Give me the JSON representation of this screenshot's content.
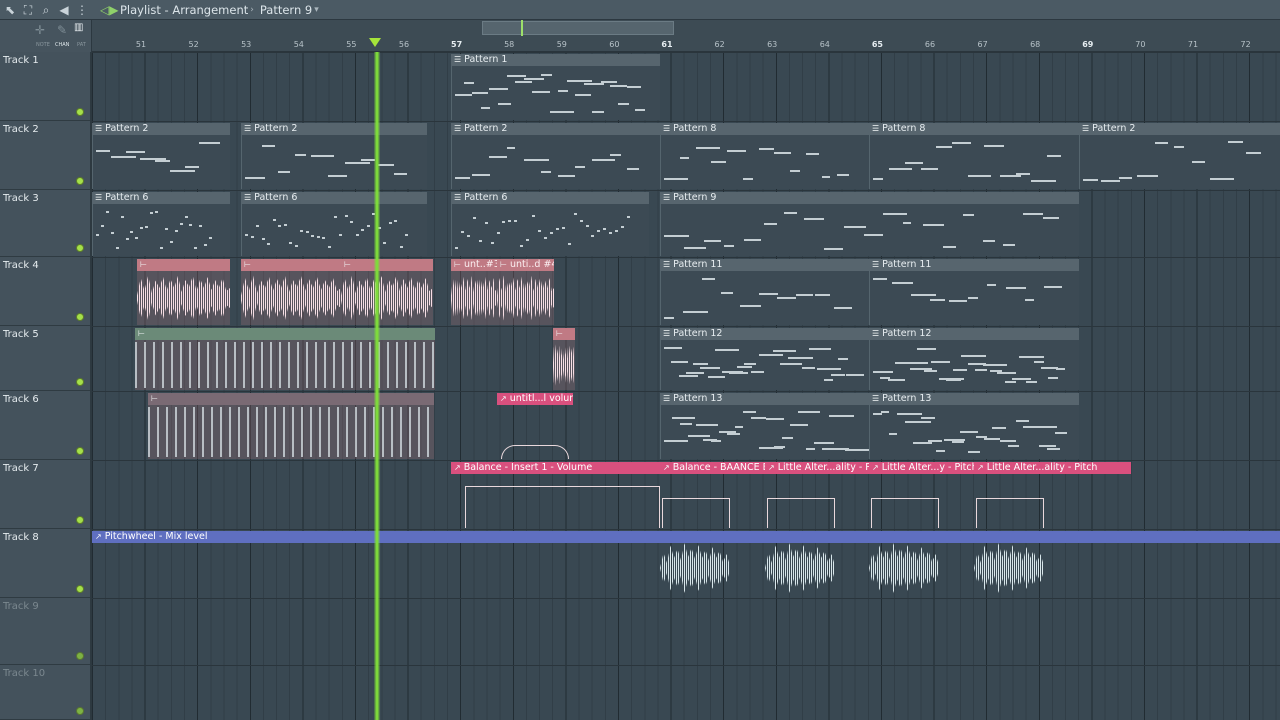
{
  "window": {
    "title": "Playlist - Arrangement",
    "pattern_selector": "Pattern 9"
  },
  "toolbar": {
    "mini_labels": [
      "NOTE",
      "CHAN",
      "PAT"
    ]
  },
  "ruler": {
    "bars": [
      "51",
      "52",
      "53",
      "54",
      "55",
      "56",
      "57",
      "58",
      "59",
      "60",
      "61",
      "62",
      "63",
      "64",
      "65",
      "66",
      "67",
      "68",
      "69",
      "70",
      "71",
      "72"
    ],
    "playhead_bar": 55.5
  },
  "tracks": [
    {
      "name": "Track 1"
    },
    {
      "name": "Track 2"
    },
    {
      "name": "Track 3"
    },
    {
      "name": "Track 4"
    },
    {
      "name": "Track 5"
    },
    {
      "name": "Track 6"
    },
    {
      "name": "Track 7"
    },
    {
      "name": "Track 8"
    },
    {
      "name": "Track 9"
    },
    {
      "name": "Track 10"
    }
  ],
  "clips": {
    "t1": [
      "Pattern 1"
    ],
    "t2": [
      "Pattern 2",
      "Pattern 2",
      "Pattern 2",
      "Pattern 8",
      "Pattern 8",
      "Pattern 2"
    ],
    "t3": [
      "Pattern 6",
      "Pattern 6",
      "Pattern 6",
      "Pattern 9"
    ],
    "t4": [
      "unt..#3",
      "unti..d #4",
      "Pattern 11",
      "Pattern 11"
    ],
    "t5": [
      "Pattern 12",
      "Pattern 12"
    ],
    "t6": [
      "untitl...l volume",
      "Pattern 13",
      "Pattern 13"
    ],
    "t7": [
      "Balance - Insert 1 - Volume",
      "Balance - BAANCE Bl",
      "Little Alter...ality - Pitch",
      "Little Alter...y - Pitch #2",
      "Little Alter...ality - Pitch"
    ],
    "t8": [
      "Pitchwheel - Mix level"
    ]
  },
  "colors": {
    "accent_green": "#7fdd3a",
    "automation_pink": "#d9507e",
    "automation_blue": "#5f6fc0",
    "audio_clip": "#c07a84"
  }
}
